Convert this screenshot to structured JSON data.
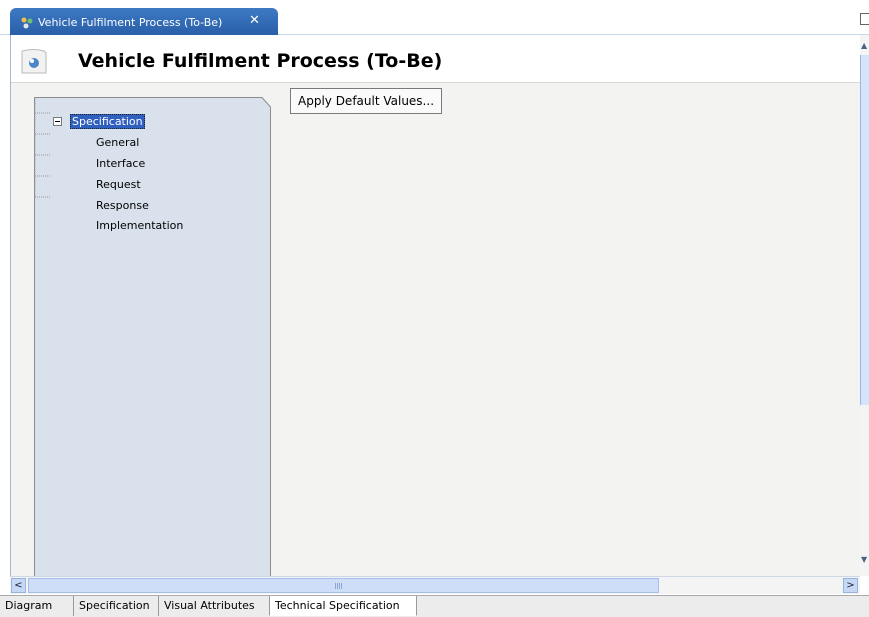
{
  "editor_tab": {
    "title": "Vehicle Fulfilment Process (To-Be)",
    "close_glyph": "✕"
  },
  "header": {
    "title": "Vehicle Fulfilment Process (To-Be)"
  },
  "tree": {
    "root": "Specification",
    "items": [
      "General",
      "Interface",
      "Request",
      "Response",
      "Implementation"
    ]
  },
  "actions": {
    "apply_defaults": "Apply Default Values..."
  },
  "bottom_tabs": [
    "Diagram",
    "Specification",
    "Visual Attributes",
    "Technical Specification"
  ],
  "active_bottom_tab": "Technical Specification",
  "colors": {
    "tab_active": "#3d79c4",
    "panel": "#d9e2ec",
    "selection": "#2f5fbf"
  }
}
